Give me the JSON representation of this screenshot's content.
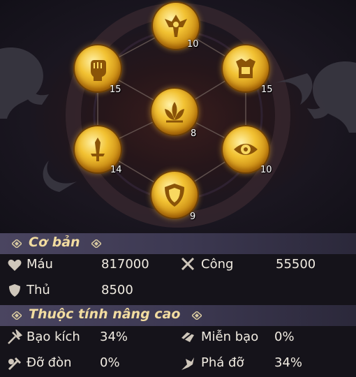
{
  "nodes": [
    {
      "name": "wing-helm",
      "level": "10"
    },
    {
      "name": "fist",
      "level": "15"
    },
    {
      "name": "armor",
      "level": "15"
    },
    {
      "name": "lotus",
      "level": "8"
    },
    {
      "name": "sword",
      "level": "14"
    },
    {
      "name": "eye",
      "level": "10"
    },
    {
      "name": "shield",
      "level": "9"
    }
  ],
  "basic": {
    "title": "Cơ bản",
    "hp_label": "Máu",
    "hp_value": "817000",
    "atk_label": "Công",
    "atk_value": "55500",
    "def_label": "Thủ",
    "def_value": "8500"
  },
  "advanced": {
    "title": "Thuộc tính nâng cao",
    "crit_label": "Bạo kích",
    "crit_value": "34%",
    "crit_res_label": "Miễn bạo",
    "crit_res_value": "0%",
    "block_label": "Đỡ đòn",
    "block_value": "0%",
    "pierce_label": "Phá đỡ",
    "pierce_value": "34%"
  },
  "colors": {
    "gold": "#f2c233",
    "title": "#f2dca0",
    "band": "#4a4560"
  }
}
